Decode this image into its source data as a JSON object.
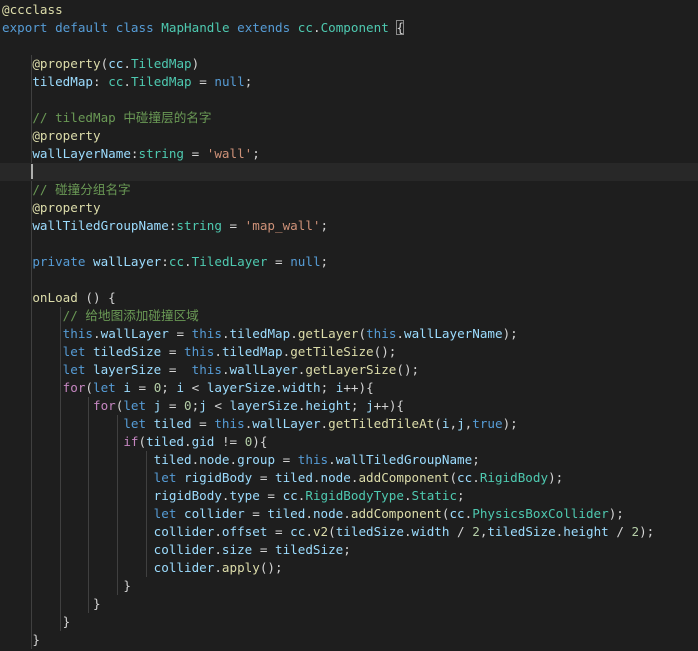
{
  "editor": {
    "language": "typescript",
    "theme_colors": {
      "background": "#1e1e1e",
      "keyword": "#569cd6",
      "control": "#c586c0",
      "type": "#4ec9b0",
      "function": "#dcdcaa",
      "variable": "#9cdcfe",
      "string": "#ce9178",
      "number": "#b5cea8",
      "comment": "#6a9955"
    },
    "lines": [
      [
        [
          "dec",
          "@ccclass"
        ]
      ],
      [
        [
          "kw",
          "export"
        ],
        [
          "pun",
          " "
        ],
        [
          "kw",
          "default"
        ],
        [
          "pun",
          " "
        ],
        [
          "kw",
          "class"
        ],
        [
          "pun",
          " "
        ],
        [
          "cls",
          "MapHandle"
        ],
        [
          "pun",
          " "
        ],
        [
          "kw",
          "extends"
        ],
        [
          "pun",
          " "
        ],
        [
          "cls",
          "cc"
        ],
        [
          "pun",
          "."
        ],
        [
          "cls",
          "Component"
        ],
        [
          "pun",
          " "
        ],
        [
          "brk",
          "{"
        ]
      ],
      [],
      [
        [
          "pun",
          "    "
        ],
        [
          "dec",
          "@property"
        ],
        [
          "pun",
          "("
        ],
        [
          "var",
          "cc"
        ],
        [
          "pun",
          "."
        ],
        [
          "cls",
          "TiledMap"
        ],
        [
          "pun",
          ")"
        ]
      ],
      [
        [
          "pun",
          "    "
        ],
        [
          "var",
          "tiledMap"
        ],
        [
          "pun",
          ": "
        ],
        [
          "cls",
          "cc"
        ],
        [
          "pun",
          "."
        ],
        [
          "cls",
          "TiledMap"
        ],
        [
          "pun",
          " = "
        ],
        [
          "kw",
          "null"
        ],
        [
          "pun",
          ";"
        ]
      ],
      [],
      [
        [
          "pun",
          "    "
        ],
        [
          "cmt",
          "// tiledMap 中碰撞层的名字"
        ]
      ],
      [
        [
          "pun",
          "    "
        ],
        [
          "dec",
          "@property"
        ]
      ],
      [
        [
          "pun",
          "    "
        ],
        [
          "var",
          "wallLayerName"
        ],
        [
          "pun",
          ":"
        ],
        [
          "cls",
          "string"
        ],
        [
          "pun",
          " = "
        ],
        [
          "str",
          "'wall'"
        ],
        [
          "pun",
          ";"
        ]
      ],
      [],
      [
        [
          "pun",
          "    "
        ],
        [
          "cmt",
          "// 碰撞分组名字"
        ]
      ],
      [
        [
          "pun",
          "    "
        ],
        [
          "dec",
          "@property"
        ]
      ],
      [
        [
          "pun",
          "    "
        ],
        [
          "var",
          "wallTiledGroupName"
        ],
        [
          "pun",
          ":"
        ],
        [
          "cls",
          "string"
        ],
        [
          "pun",
          " = "
        ],
        [
          "str",
          "'map_wall'"
        ],
        [
          "pun",
          ";"
        ]
      ],
      [],
      [
        [
          "pun",
          "    "
        ],
        [
          "kw",
          "private"
        ],
        [
          "pun",
          " "
        ],
        [
          "var",
          "wallLayer"
        ],
        [
          "pun",
          ":"
        ],
        [
          "cls",
          "cc"
        ],
        [
          "pun",
          "."
        ],
        [
          "cls",
          "TiledLayer"
        ],
        [
          "pun",
          " = "
        ],
        [
          "kw",
          "null"
        ],
        [
          "pun",
          ";"
        ]
      ],
      [],
      [
        [
          "pun",
          "    "
        ],
        [
          "fn",
          "onLoad"
        ],
        [
          "pun",
          " () {"
        ]
      ],
      [
        [
          "pun",
          "        "
        ],
        [
          "cmt",
          "// 给地图添加碰撞区域"
        ]
      ],
      [
        [
          "pun",
          "        "
        ],
        [
          "kw",
          "this"
        ],
        [
          "pun",
          "."
        ],
        [
          "var",
          "wallLayer"
        ],
        [
          "pun",
          " = "
        ],
        [
          "kw",
          "this"
        ],
        [
          "pun",
          "."
        ],
        [
          "var",
          "tiledMap"
        ],
        [
          "pun",
          "."
        ],
        [
          "fn",
          "getLayer"
        ],
        [
          "pun",
          "("
        ],
        [
          "kw",
          "this"
        ],
        [
          "pun",
          "."
        ],
        [
          "var",
          "wallLayerName"
        ],
        [
          "pun",
          ");"
        ]
      ],
      [
        [
          "pun",
          "        "
        ],
        [
          "kw",
          "let"
        ],
        [
          "pun",
          " "
        ],
        [
          "var",
          "tiledSize"
        ],
        [
          "pun",
          " = "
        ],
        [
          "kw",
          "this"
        ],
        [
          "pun",
          "."
        ],
        [
          "var",
          "tiledMap"
        ],
        [
          "pun",
          "."
        ],
        [
          "fn",
          "getTileSize"
        ],
        [
          "pun",
          "();"
        ]
      ],
      [
        [
          "pun",
          "        "
        ],
        [
          "kw",
          "let"
        ],
        [
          "pun",
          " "
        ],
        [
          "var",
          "layerSize"
        ],
        [
          "pun",
          " =  "
        ],
        [
          "kw",
          "this"
        ],
        [
          "pun",
          "."
        ],
        [
          "var",
          "wallLayer"
        ],
        [
          "pun",
          "."
        ],
        [
          "fn",
          "getLayerSize"
        ],
        [
          "pun",
          "();"
        ]
      ],
      [
        [
          "pun",
          "        "
        ],
        [
          "ctl",
          "for"
        ],
        [
          "pun",
          "("
        ],
        [
          "kw",
          "let"
        ],
        [
          "pun",
          " "
        ],
        [
          "var",
          "i"
        ],
        [
          "pun",
          " = "
        ],
        [
          "num",
          "0"
        ],
        [
          "pun",
          "; "
        ],
        [
          "var",
          "i"
        ],
        [
          "pun",
          " < "
        ],
        [
          "var",
          "layerSize"
        ],
        [
          "pun",
          "."
        ],
        [
          "var",
          "width"
        ],
        [
          "pun",
          "; "
        ],
        [
          "var",
          "i"
        ],
        [
          "pun",
          "++){"
        ]
      ],
      [
        [
          "pun",
          "            "
        ],
        [
          "ctl",
          "for"
        ],
        [
          "pun",
          "("
        ],
        [
          "kw",
          "let"
        ],
        [
          "pun",
          " "
        ],
        [
          "var",
          "j"
        ],
        [
          "pun",
          " = "
        ],
        [
          "num",
          "0"
        ],
        [
          "pun",
          ";"
        ],
        [
          "var",
          "j"
        ],
        [
          "pun",
          " < "
        ],
        [
          "var",
          "layerSize"
        ],
        [
          "pun",
          "."
        ],
        [
          "var",
          "height"
        ],
        [
          "pun",
          "; "
        ],
        [
          "var",
          "j"
        ],
        [
          "pun",
          "++){"
        ]
      ],
      [
        [
          "pun",
          "                "
        ],
        [
          "kw",
          "let"
        ],
        [
          "pun",
          " "
        ],
        [
          "var",
          "tiled"
        ],
        [
          "pun",
          " = "
        ],
        [
          "kw",
          "this"
        ],
        [
          "pun",
          "."
        ],
        [
          "var",
          "wallLayer"
        ],
        [
          "pun",
          "."
        ],
        [
          "fn",
          "getTiledTileAt"
        ],
        [
          "pun",
          "("
        ],
        [
          "var",
          "i"
        ],
        [
          "pun",
          ","
        ],
        [
          "var",
          "j"
        ],
        [
          "pun",
          ","
        ],
        [
          "kw",
          "true"
        ],
        [
          "pun",
          ");"
        ]
      ],
      [
        [
          "pun",
          "                "
        ],
        [
          "ctl",
          "if"
        ],
        [
          "pun",
          "("
        ],
        [
          "var",
          "tiled"
        ],
        [
          "pun",
          "."
        ],
        [
          "var",
          "gid"
        ],
        [
          "pun",
          " != "
        ],
        [
          "num",
          "0"
        ],
        [
          "pun",
          "){"
        ]
      ],
      [
        [
          "pun",
          "                    "
        ],
        [
          "var",
          "tiled"
        ],
        [
          "pun",
          "."
        ],
        [
          "var",
          "node"
        ],
        [
          "pun",
          "."
        ],
        [
          "var",
          "group"
        ],
        [
          "pun",
          " = "
        ],
        [
          "kw",
          "this"
        ],
        [
          "pun",
          "."
        ],
        [
          "var",
          "wallTiledGroupName"
        ],
        [
          "pun",
          ";"
        ]
      ],
      [
        [
          "pun",
          "                    "
        ],
        [
          "kw",
          "let"
        ],
        [
          "pun",
          " "
        ],
        [
          "var",
          "rigidBody"
        ],
        [
          "pun",
          " = "
        ],
        [
          "var",
          "tiled"
        ],
        [
          "pun",
          "."
        ],
        [
          "var",
          "node"
        ],
        [
          "pun",
          "."
        ],
        [
          "fn",
          "addComponent"
        ],
        [
          "pun",
          "("
        ],
        [
          "var",
          "cc"
        ],
        [
          "pun",
          "."
        ],
        [
          "cls",
          "RigidBody"
        ],
        [
          "pun",
          ");"
        ]
      ],
      [
        [
          "pun",
          "                    "
        ],
        [
          "var",
          "rigidBody"
        ],
        [
          "pun",
          "."
        ],
        [
          "var",
          "type"
        ],
        [
          "pun",
          " = "
        ],
        [
          "var",
          "cc"
        ],
        [
          "pun",
          "."
        ],
        [
          "cls",
          "RigidBodyType"
        ],
        [
          "pun",
          "."
        ],
        [
          "cls",
          "Static"
        ],
        [
          "pun",
          ";"
        ]
      ],
      [
        [
          "pun",
          "                    "
        ],
        [
          "kw",
          "let"
        ],
        [
          "pun",
          " "
        ],
        [
          "var",
          "collider"
        ],
        [
          "pun",
          " = "
        ],
        [
          "var",
          "tiled"
        ],
        [
          "pun",
          "."
        ],
        [
          "var",
          "node"
        ],
        [
          "pun",
          "."
        ],
        [
          "fn",
          "addComponent"
        ],
        [
          "pun",
          "("
        ],
        [
          "var",
          "cc"
        ],
        [
          "pun",
          "."
        ],
        [
          "cls",
          "PhysicsBoxCollider"
        ],
        [
          "pun",
          ");"
        ]
      ],
      [
        [
          "pun",
          "                    "
        ],
        [
          "var",
          "collider"
        ],
        [
          "pun",
          "."
        ],
        [
          "var",
          "offset"
        ],
        [
          "pun",
          " = "
        ],
        [
          "var",
          "cc"
        ],
        [
          "pun",
          "."
        ],
        [
          "fn",
          "v2"
        ],
        [
          "pun",
          "("
        ],
        [
          "var",
          "tiledSize"
        ],
        [
          "pun",
          "."
        ],
        [
          "var",
          "width"
        ],
        [
          "pun",
          " / "
        ],
        [
          "num",
          "2"
        ],
        [
          "pun",
          ","
        ],
        [
          "var",
          "tiledSize"
        ],
        [
          "pun",
          "."
        ],
        [
          "var",
          "height"
        ],
        [
          "pun",
          " / "
        ],
        [
          "num",
          "2"
        ],
        [
          "pun",
          ");"
        ]
      ],
      [
        [
          "pun",
          "                    "
        ],
        [
          "var",
          "collider"
        ],
        [
          "pun",
          "."
        ],
        [
          "var",
          "size"
        ],
        [
          "pun",
          " = "
        ],
        [
          "var",
          "tiledSize"
        ],
        [
          "pun",
          ";"
        ]
      ],
      [
        [
          "pun",
          "                    "
        ],
        [
          "var",
          "collider"
        ],
        [
          "pun",
          "."
        ],
        [
          "fn",
          "apply"
        ],
        [
          "pun",
          "();"
        ]
      ],
      [
        [
          "pun",
          "                }"
        ]
      ],
      [
        [
          "pun",
          "            }"
        ]
      ],
      [
        [
          "pun",
          "        }"
        ]
      ],
      [
        [
          "pun",
          "    }"
        ]
      ]
    ]
  }
}
